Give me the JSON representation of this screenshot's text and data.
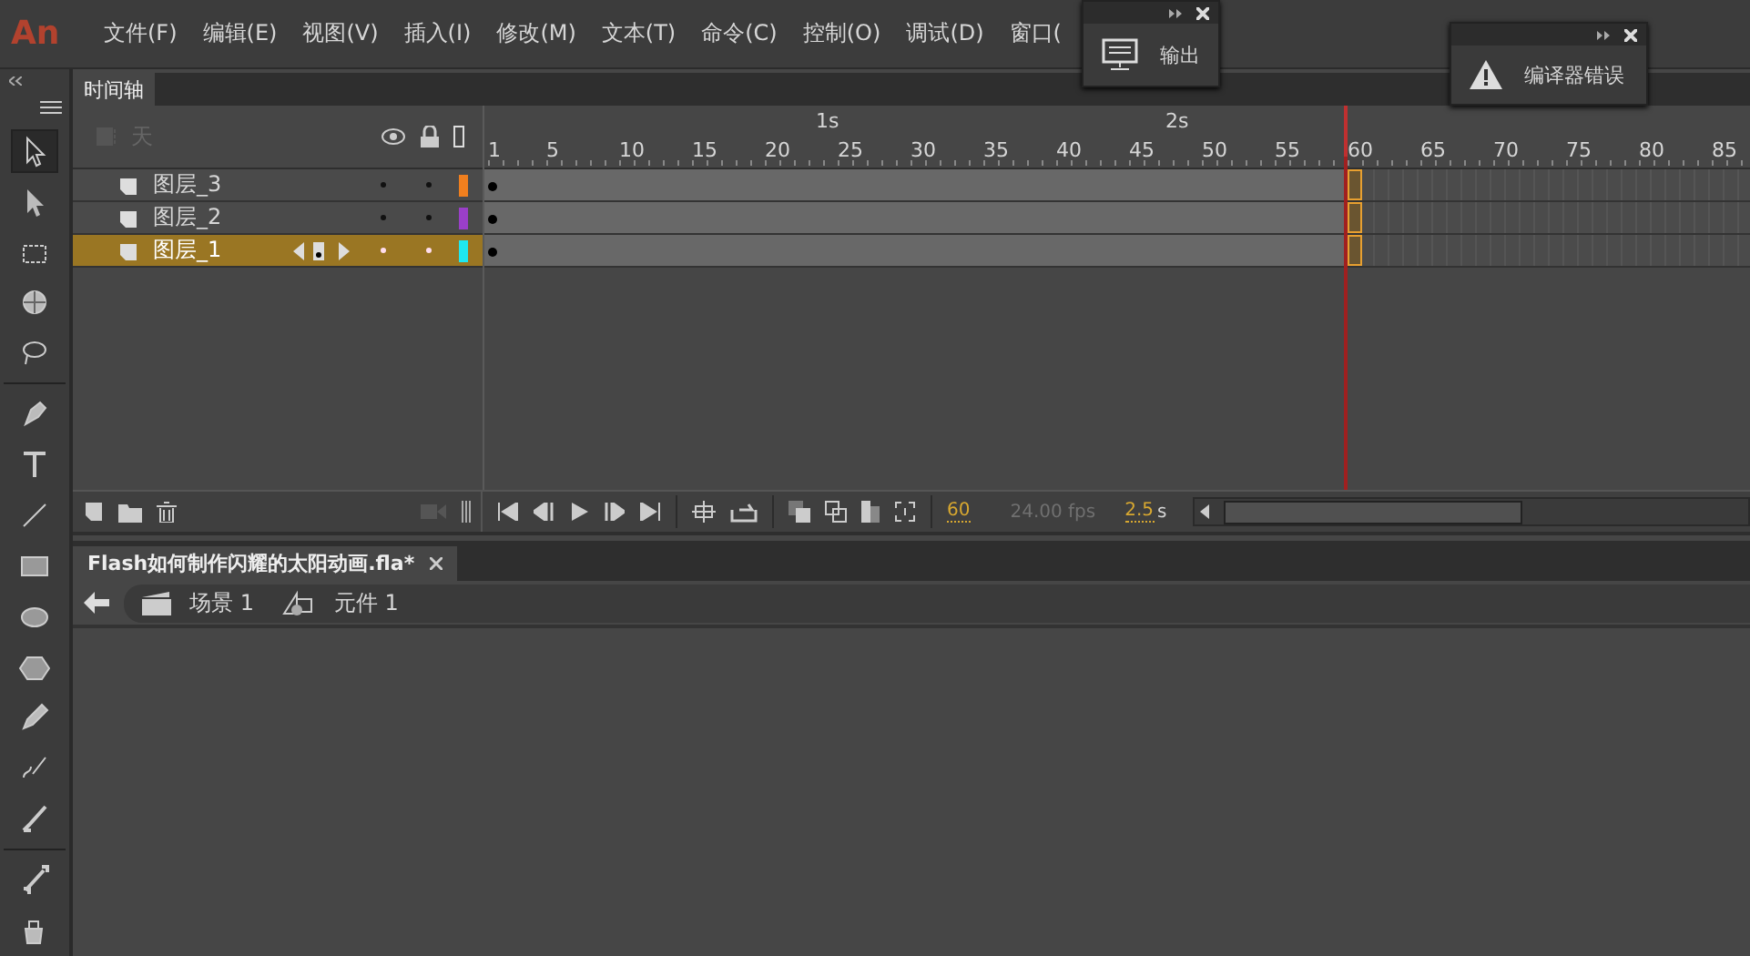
{
  "app": {
    "logo": "An"
  },
  "menu": [
    "文件(F)",
    "编辑(E)",
    "视图(V)",
    "插入(I)",
    "修改(M)",
    "文本(T)",
    "命令(C)",
    "控制(O)",
    "调试(D)",
    "窗口("
  ],
  "floating_panels": [
    {
      "kind": "output",
      "label": "输出"
    },
    {
      "kind": "errors",
      "label": "编译器错误"
    }
  ],
  "toolbar": {
    "tools": [
      {
        "selected": true
      },
      {
        "selected": false
      },
      {
        "selected": false
      },
      {
        "selected": false
      },
      {
        "selected": false
      },
      {
        "selected": false
      },
      {
        "selected": false
      },
      {
        "selected": false
      },
      {
        "selected": false
      },
      {
        "selected": false
      },
      {
        "selected": false
      },
      {
        "selected": false
      },
      {
        "selected": false
      },
      {
        "selected": false
      },
      {
        "selected": false
      },
      {
        "selected": false
      }
    ]
  },
  "timeline": {
    "tab": "时间轴",
    "header_label": "天",
    "ruler": [
      "1",
      "5",
      "10",
      "15",
      "20",
      "25",
      "30",
      "35",
      "40",
      "45",
      "50",
      "55",
      "60",
      "65",
      "70",
      "75",
      "80",
      "85"
    ],
    "seconds": [
      "1s",
      "2s"
    ],
    "layers": [
      {
        "name": "图层_3",
        "color": "#f07f1e",
        "selected": false
      },
      {
        "name": "图层_2",
        "color": "#9a3fc8",
        "selected": false
      },
      {
        "name": "图层_1",
        "color": "#1ee8f0",
        "selected": true
      }
    ],
    "current_frame": "60",
    "fps": "24.00 fps",
    "elapsed": "2.5",
    "elapsed_unit": "s"
  },
  "document": {
    "tab": "Flash如何制作闪耀的太阳动画.fla*",
    "breadcrumb": [
      {
        "kind": "scene",
        "label": "场景 1"
      },
      {
        "kind": "symbol",
        "label": "元件 1"
      }
    ]
  }
}
